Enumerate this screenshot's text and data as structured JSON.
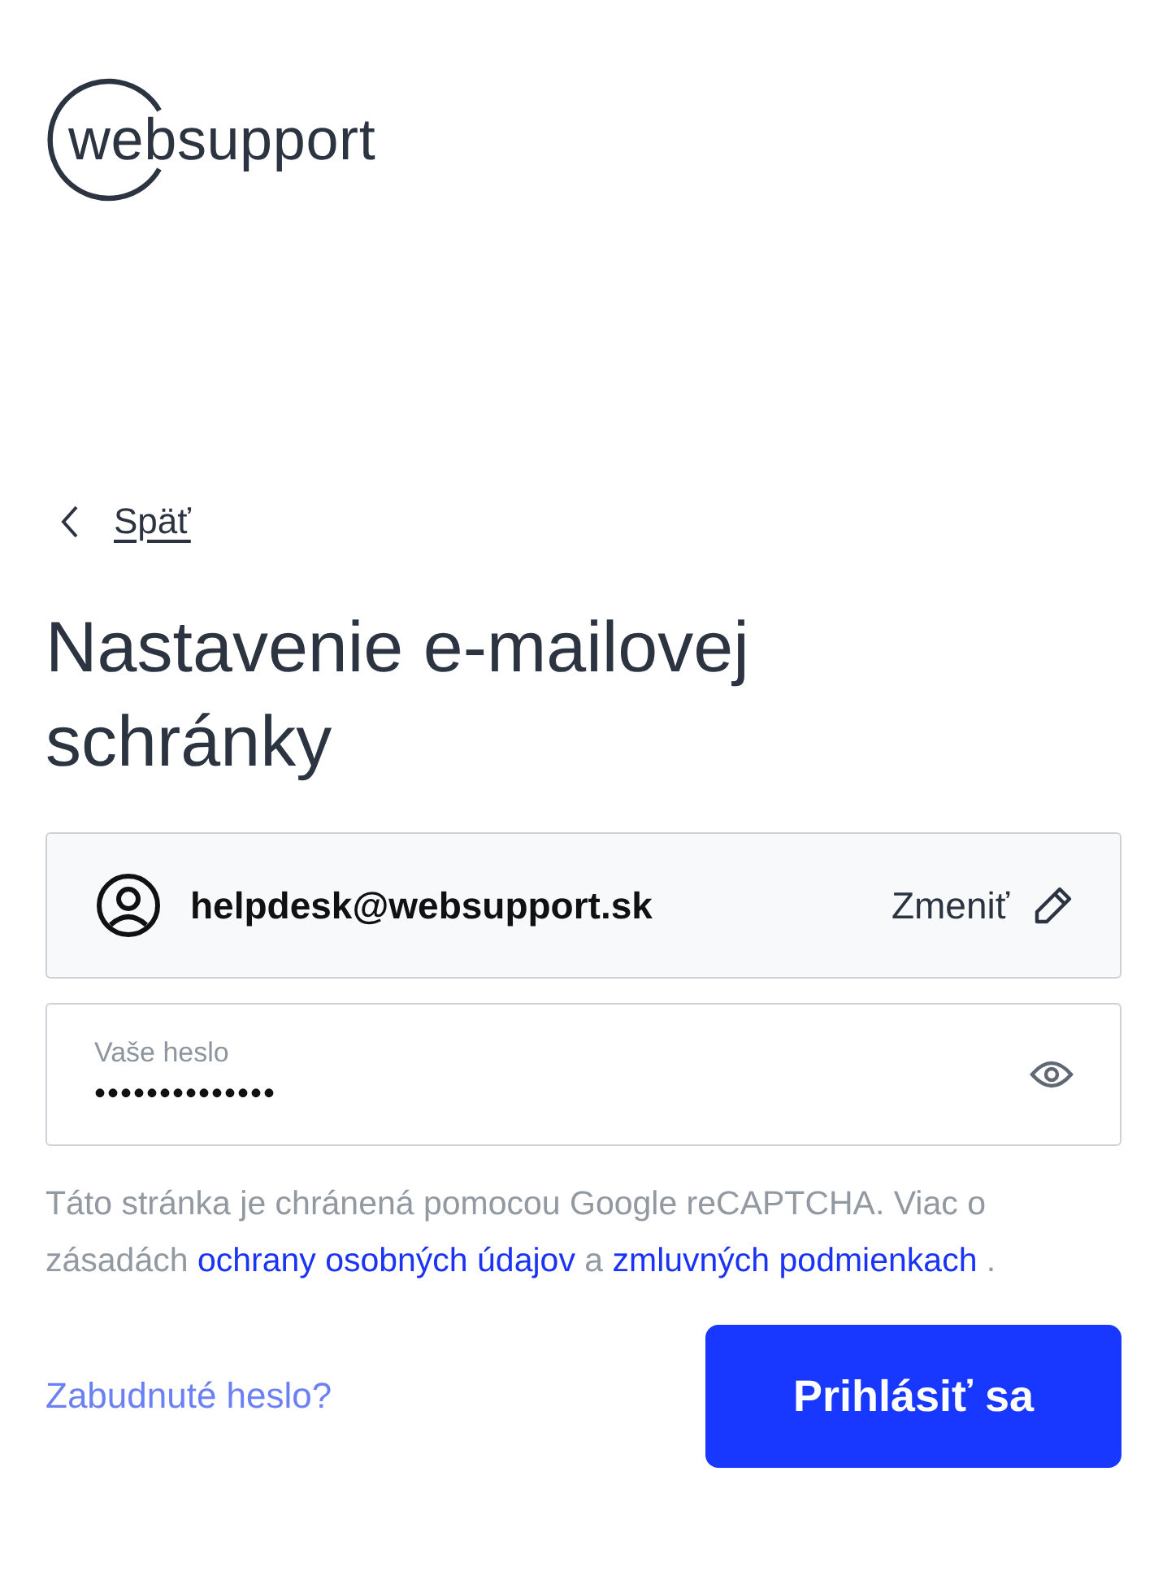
{
  "logo": {
    "text": "websupport"
  },
  "back_link": {
    "label": "Späť"
  },
  "title": "Nastavenie e-mailovej schránky",
  "account": {
    "email": "helpdesk@websupport.sk",
    "change_label": "Zmeniť"
  },
  "password_field": {
    "label": "Vaše heslo",
    "value": "••••••••••••••",
    "revealed": false
  },
  "notice": [
    {
      "kind": "text",
      "text": "Táto stránka je chránená pomocou Google reCAPTCHA. Viac o zásadách "
    },
    {
      "kind": "link",
      "text": "ochrany osobných údajov"
    },
    {
      "kind": "text",
      "text": " a "
    },
    {
      "kind": "link",
      "text": "zmluvných podmienkach"
    },
    {
      "kind": "text",
      "text": " ."
    }
  ],
  "forgot_link": {
    "label": "Zabudnuté heslo?"
  },
  "submit_button": {
    "label": "Prihlásiť sa"
  }
}
